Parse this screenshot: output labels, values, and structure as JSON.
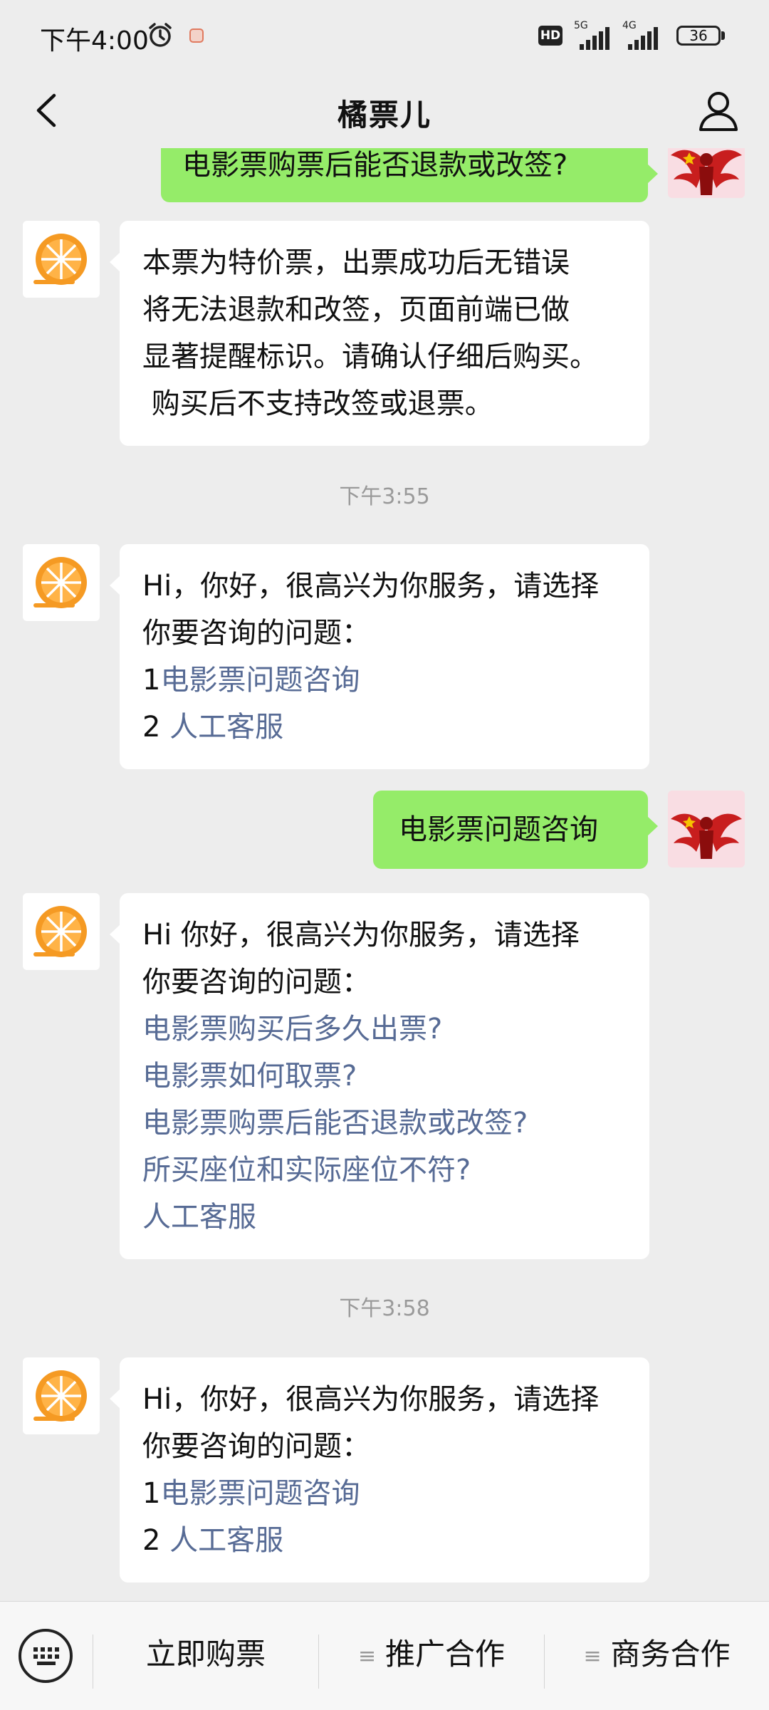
{
  "status_bar": {
    "time": "下午4:00",
    "hd_label": "HD",
    "signal_1_label": "5G",
    "signal_2_label": "4G",
    "battery": "36",
    "icons": [
      "alarm-icon",
      "app-notification-icon",
      "hd-icon",
      "signal-5g-icon",
      "signal-4g-icon",
      "battery-icon"
    ]
  },
  "nav": {
    "title": "橘票儿",
    "icons": [
      "back-chevron-icon",
      "person-icon"
    ]
  },
  "messages": [
    {
      "sender": "user",
      "lines": [
        "电影票购票后能否退款或改签?"
      ]
    },
    {
      "sender": "bot",
      "lines": [
        "本票为特价票，出票成功后无错误",
        "将无法退款和改签，页面前端已做",
        "显著提醒标识。请确认仔细后购买。",
        " 购买后不支持改签或退票。"
      ]
    },
    {
      "type": "timestamp",
      "text": "下午3:55"
    },
    {
      "sender": "bot",
      "lines": [
        "Hi，你好，很高兴为你服务，请选择",
        "你要咨询的问题："
      ],
      "options": [
        {
          "num": "1",
          "text": "电影票问题咨询"
        },
        {
          "num": "2",
          "text": "人工客服"
        }
      ]
    },
    {
      "sender": "user",
      "lines": [
        "电影票问题咨询"
      ]
    },
    {
      "sender": "bot",
      "lines": [
        "Hi 你好，很高兴为你服务，请选择",
        "你要咨询的问题："
      ],
      "links": [
        "电影票购买后多久出票?",
        "电影票如何取票?",
        "电影票购票后能否退款或改签?",
        "所买座位和实际座位不符?",
        "人工客服"
      ]
    },
    {
      "type": "timestamp",
      "text": "下午3:58"
    },
    {
      "sender": "bot",
      "lines": [
        "Hi，你好，很高兴为你服务，请选择",
        "你要咨询的问题："
      ],
      "options": [
        {
          "num": "1",
          "text": "电影票问题咨询"
        },
        {
          "num": "2",
          "text": "人工客服"
        }
      ]
    }
  ],
  "bottom_menu": {
    "keyboard_icon": "keyboard-icon",
    "items": [
      {
        "label": "立即购票",
        "has_submenu": false
      },
      {
        "label": "推广合作",
        "has_submenu": true
      },
      {
        "label": "商务合作",
        "has_submenu": true
      }
    ]
  },
  "colors": {
    "background": "#ededed",
    "bot_bubble": "#ffffff",
    "user_bubble": "#95ec69",
    "link": "#576b95",
    "timestamp": "#9a9a9a",
    "brand_orange": "#f59a23"
  }
}
